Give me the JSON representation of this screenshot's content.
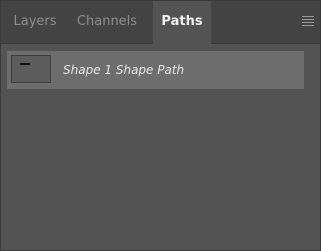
{
  "tabs": [
    {
      "label": "Layers"
    },
    {
      "label": "Channels"
    },
    {
      "label": "Paths",
      "active": true
    }
  ],
  "panel_menu": {
    "icon": "hamburger-menu-icon"
  },
  "paths": [
    {
      "name": "Shape 1 Shape Path",
      "selected": true
    }
  ],
  "colors": {
    "panel_bg": "#535353",
    "tabbar_bg": "#434343",
    "selected_row": "#6d6d6d",
    "active_tab_text": "#f0f0f0",
    "inactive_tab_text": "#8e8e8e"
  }
}
